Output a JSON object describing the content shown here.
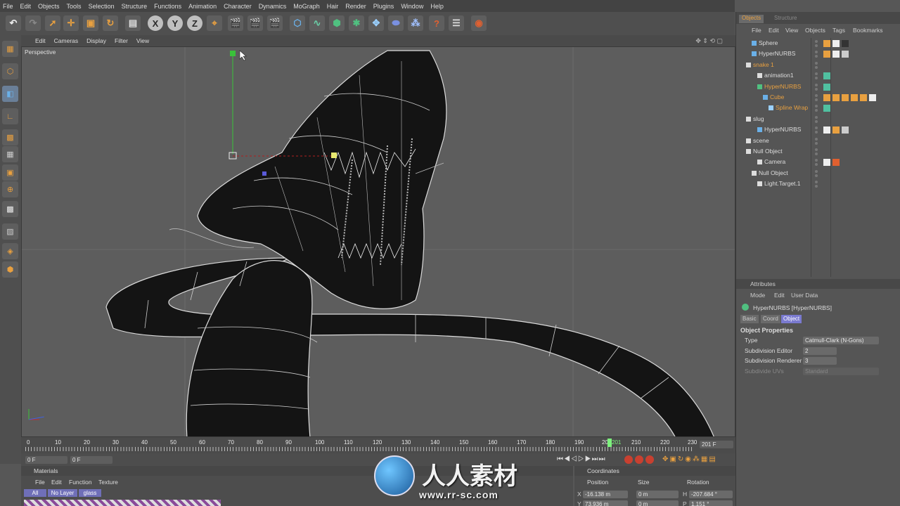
{
  "menubar": [
    "File",
    "Edit",
    "Objects",
    "Tools",
    "Selection",
    "Structure",
    "Functions",
    "Animation",
    "Character",
    "Dynamics",
    "MoGraph",
    "Hair",
    "Render",
    "Plugins",
    "Window",
    "Help"
  ],
  "toolbar_icons": [
    {
      "name": "undo-icon",
      "glyph": "↶",
      "color": "#eee"
    },
    {
      "name": "redo-icon",
      "glyph": "↷",
      "color": "#888"
    },
    {
      "name": "live-selection-icon",
      "glyph": "➚",
      "color": "#e8a040"
    },
    {
      "name": "move-icon",
      "glyph": "✛",
      "color": "#e8a040"
    },
    {
      "name": "scale-icon",
      "glyph": "▣",
      "color": "#e8a040"
    },
    {
      "name": "rotate-icon",
      "glyph": "↻",
      "color": "#e8a040"
    },
    {
      "name": "model-mode-icon",
      "glyph": "▤",
      "color": "#ddd"
    },
    {
      "name": "x-axis-icon",
      "glyph": "X",
      "color": "#2a2a2a"
    },
    {
      "name": "y-axis-icon",
      "glyph": "Y",
      "color": "#2a2a2a"
    },
    {
      "name": "z-axis-icon",
      "glyph": "Z",
      "color": "#2a2a2a"
    },
    {
      "name": "coordinate-system-icon",
      "glyph": "⌖",
      "color": "#e8a040"
    },
    {
      "name": "render-view-icon",
      "glyph": "🎬",
      "color": "#e06030"
    },
    {
      "name": "render-picture-viewer-icon",
      "glyph": "🎬",
      "color": "#e06030"
    },
    {
      "name": "render-settings-icon",
      "glyph": "🎬",
      "color": "#ddd"
    },
    {
      "name": "cube-icon",
      "glyph": "⬡",
      "color": "#6ab0e8"
    },
    {
      "name": "spline-icon",
      "glyph": "∿",
      "color": "#6ad0a8"
    },
    {
      "name": "nurbs-icon",
      "glyph": "⬢",
      "color": "#50c080"
    },
    {
      "name": "array-icon",
      "glyph": "✱",
      "color": "#50c080"
    },
    {
      "name": "deformer-icon",
      "glyph": "✥",
      "color": "#9ad0ff"
    },
    {
      "name": "scene-icon",
      "glyph": "⬬",
      "color": "#7a90e0"
    },
    {
      "name": "particles-icon",
      "glyph": "⁂",
      "color": "#a0c0ff"
    },
    {
      "name": "camera-icon",
      "glyph": "?",
      "color": "#e06030"
    },
    {
      "name": "light-icon",
      "glyph": "☰",
      "color": "#ddd"
    },
    {
      "name": "xpresso-icon",
      "glyph": "◉",
      "color": "#e06030"
    }
  ],
  "left_icons": [
    "make-editable-icon",
    "object-mode-icon",
    "points-mode-icon",
    "edges-mode-icon",
    "polygons-mode-icon",
    "model-icon",
    "texture-icon",
    "axis-icon",
    "snap-icon",
    "workplane-icon",
    "locked-workplane-icon",
    "soft-selection-icon"
  ],
  "viewport": {
    "menu": [
      "Edit",
      "Cameras",
      "Display",
      "Filter",
      "View"
    ],
    "label": "Perspective"
  },
  "timeline": {
    "ticks": [
      "0",
      "10",
      "20",
      "30",
      "40",
      "50",
      "60",
      "70",
      "80",
      "90",
      "100",
      "110",
      "120",
      "130",
      "140",
      "150",
      "160",
      "170",
      "180",
      "190",
      "200",
      "201",
      "210",
      "220",
      "230"
    ],
    "current_frame": "201 F",
    "start_frame": "0 F",
    "end_frame_field": "0 F"
  },
  "materials": {
    "title": "Materials",
    "menu": [
      "File",
      "Edit",
      "Function",
      "Texture"
    ],
    "filters": [
      "All",
      "No Layer",
      "glass"
    ]
  },
  "coordinates": {
    "title": "Coordinates",
    "headers": [
      "Position",
      "Size",
      "Rotation"
    ],
    "rows": [
      {
        "axis": "X",
        "pos": "-16.138 m",
        "size": "0 m",
        "rot_axis": "H",
        "rot": "-207.684 °"
      },
      {
        "axis": "Y",
        "pos": "73.936 m",
        "size": "0 m",
        "rot_axis": "P",
        "rot": "1.151 °"
      }
    ]
  },
  "objects_panel": {
    "tabs": [
      "Objects",
      "Structure"
    ],
    "menu": [
      "File",
      "Edit",
      "View",
      "Objects",
      "Tags",
      "Bookmarks"
    ],
    "rows": [
      {
        "label": "Sphere",
        "indent": 1,
        "color": "#ddd",
        "icon": "#6ab0e8"
      },
      {
        "label": "HyperNURBS",
        "indent": 1,
        "color": "#ddd",
        "icon": "#6ab0e8"
      },
      {
        "label": "snake 1",
        "indent": 0,
        "color": "#e8a040",
        "icon": "#ddd"
      },
      {
        "label": "animation1",
        "indent": 2,
        "color": "#ddd",
        "icon": "#ddd"
      },
      {
        "label": "HyperNURBS",
        "indent": 2,
        "color": "#e8a040",
        "icon": "#50c080"
      },
      {
        "label": "Cube",
        "indent": 3,
        "color": "#e8a040",
        "icon": "#6ab0e8"
      },
      {
        "label": "Spline Wrap",
        "indent": 4,
        "color": "#e8a040",
        "icon": "#9ad0ff"
      },
      {
        "label": "slug",
        "indent": 0,
        "color": "#ddd",
        "icon": "#ddd"
      },
      {
        "label": "HyperNURBS",
        "indent": 2,
        "color": "#ddd",
        "icon": "#6ab0e8"
      },
      {
        "label": "scene",
        "indent": 0,
        "color": "#ddd",
        "icon": "#ddd"
      },
      {
        "label": "Null Object",
        "indent": 0,
        "color": "#ddd",
        "icon": "#ddd"
      },
      {
        "label": "Camera",
        "indent": 2,
        "color": "#ddd",
        "icon": "#ddd"
      },
      {
        "label": "Null Object",
        "indent": 1,
        "color": "#ddd",
        "icon": "#ddd"
      },
      {
        "label": "Light.Target.1",
        "indent": 2,
        "color": "#ddd",
        "icon": "#ddd"
      }
    ]
  },
  "attributes": {
    "title": "Attributes",
    "menu": [
      "Mode",
      "Edit",
      "User Data"
    ],
    "object_name": "HyperNURBS [HyperNURBS]",
    "tabs": [
      "Basic",
      "Coord",
      "Object"
    ],
    "section": "Object Properties",
    "props": [
      {
        "label": "Type",
        "value": "Catmull-Clark (N-Gons)",
        "dim": false
      },
      {
        "label": "Subdivision Editor",
        "value": "2",
        "dim": false
      },
      {
        "label": "Subdivision Renderer",
        "value": "3",
        "dim": false
      },
      {
        "label": "Subdivide UVs",
        "value": "Standard",
        "dim": true
      }
    ]
  },
  "watermark": {
    "cn": "人人素材",
    "url": "www.rr-sc.com"
  }
}
